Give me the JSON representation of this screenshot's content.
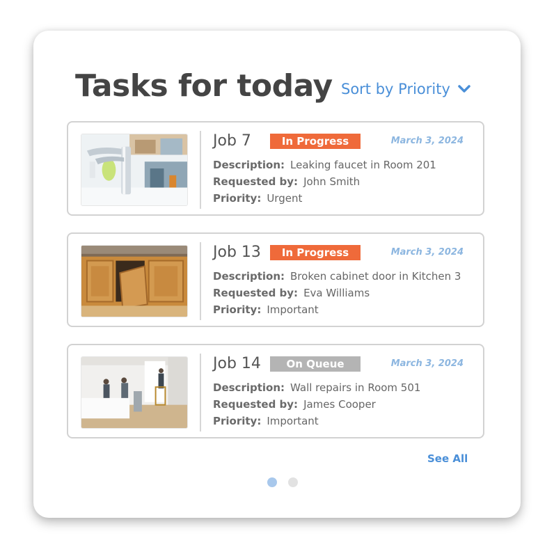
{
  "header": {
    "title": "Tasks for today",
    "sort_label": "Sort by Priority",
    "sort_icon": "chevron-down-icon"
  },
  "labels": {
    "description": "Description:",
    "requested_by": "Requested by:",
    "priority": "Priority:"
  },
  "jobs": [
    {
      "name": "Job 7",
      "status": "In Progress",
      "status_color": "#ef6a3a",
      "date": "March 3, 2024",
      "description": "Leaking faucet in Room 201",
      "requested_by": "John Smith",
      "priority": "Urgent",
      "image": "faucet-photo"
    },
    {
      "name": "Job 13",
      "status": "In Progress",
      "status_color": "#ef6a3a",
      "date": "March 3, 2024",
      "description": "Broken cabinet door in Kitchen 3",
      "requested_by": "Eva Williams",
      "priority": "Important",
      "image": "cabinet-photo"
    },
    {
      "name": "Job 14",
      "status": "On Queue",
      "status_color": "#b4b4b4",
      "date": "March 3, 2024",
      "description": "Wall repairs in Room 501",
      "requested_by": "James Cooper",
      "priority": "Important",
      "image": "renovation-photo"
    }
  ],
  "footer": {
    "see_all": "See All",
    "pagination": {
      "pages": 2,
      "active": 1
    }
  },
  "colors": {
    "accent": "#4a8fd8",
    "active_dot": "#a8c8ec",
    "inactive_dot": "#e2e2e2"
  }
}
